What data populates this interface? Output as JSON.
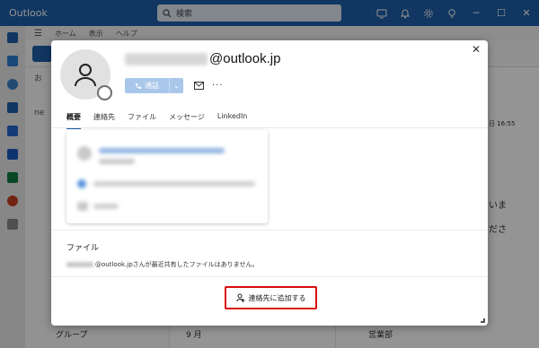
{
  "app": {
    "title": "Outlook",
    "search_placeholder": "検索"
  },
  "ribbon": {
    "tabs": [
      "ホーム",
      "表示",
      "ヘルプ"
    ]
  },
  "background": {
    "folder_labels": [
      "お",
      "ne"
    ],
    "bottom_left": "グループ",
    "bottom_mid": "9 月",
    "bottom_right": "営業部",
    "reading_snippets": [
      "いま",
      "ださ"
    ],
    "reading_time": "日 16:55"
  },
  "dialog": {
    "email_domain": "@outlook.jp",
    "call_label": "通話",
    "tabs": [
      "概要",
      "連絡先",
      "ファイル",
      "メッセージ",
      "LinkedIn"
    ],
    "files_title": "ファイル",
    "files_domain": "@outlook.jp",
    "files_message": " さんが最近共有したファイルはありません。",
    "add_contact_label": "連絡先に追加する"
  },
  "colors": {
    "brand": "#1d5ea8",
    "highlight": "#d90d0d"
  }
}
